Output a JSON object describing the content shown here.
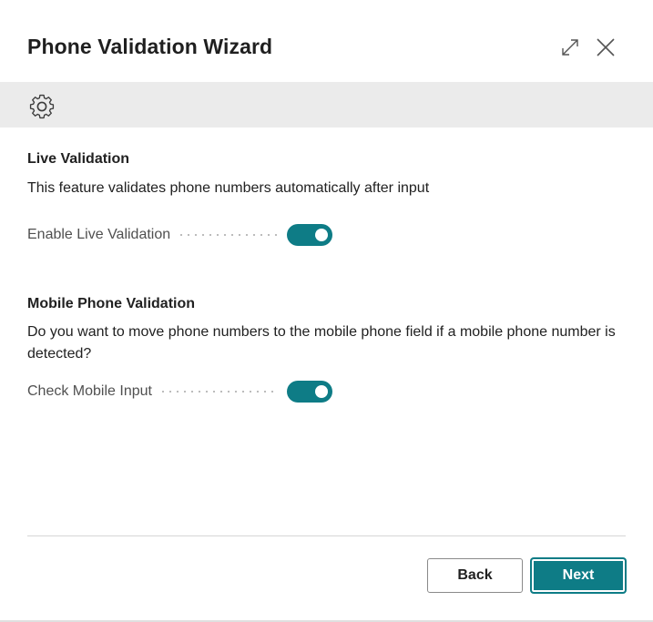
{
  "dialog": {
    "title": "Phone Validation Wizard",
    "window_controls": {
      "expand_icon": "expand-icon",
      "close_icon": "close-icon"
    },
    "action_bar": {
      "settings_icon": "gear-icon"
    }
  },
  "sections": [
    {
      "title": "Live Validation",
      "description": "This feature validates phone numbers automatically after input",
      "field": {
        "label": "Enable Live Validation",
        "value": "on"
      }
    },
    {
      "title": "Mobile Phone Validation",
      "description": "Do you want to move phone numbers to the mobile phone field if a mobile phone number is detected?",
      "field": {
        "label": "Check Mobile Input",
        "value": "on"
      }
    }
  ],
  "footer": {
    "back_label": "Back",
    "next_label": "Next"
  },
  "colors": {
    "accent": "#0e7c86",
    "action_bar": "#ebebeb",
    "title_text": "#1f1f1f"
  }
}
